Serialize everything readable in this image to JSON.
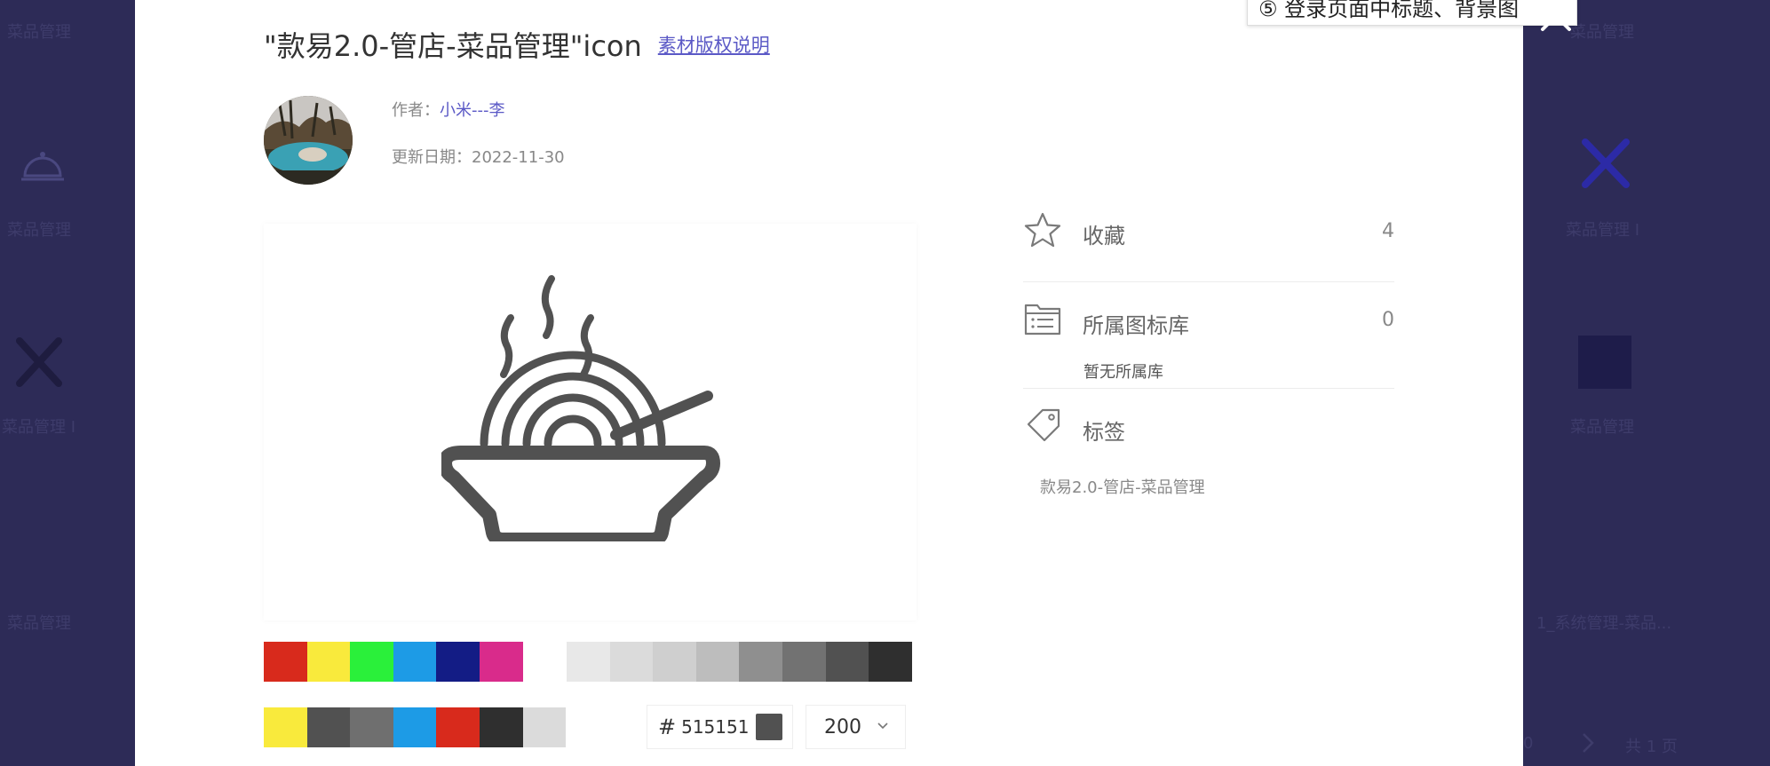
{
  "background": {
    "left_labels": [
      "菜品管理",
      "菜品管理",
      "菜品管理 I",
      "菜品管理"
    ],
    "right_labels": [
      "菜品管理",
      "菜品管理 I",
      "菜品管理",
      "1_系统管理-菜品..."
    ],
    "pager_total": "共 1 页",
    "pager_prev": "0"
  },
  "modal": {
    "title": "\"款易2.0-管店-菜品管理\"icon",
    "copyright_link": "素材版权说明",
    "author_label": "作者：",
    "author_name": "小米---李",
    "date_label": "更新日期：",
    "date_value": "2022-11-30",
    "tooltip": "⑤ 登录页面中标题、背景图",
    "close_icon": "close-icon",
    "preview_icon": "noodle-bowl-icon",
    "preview_color": "#515151"
  },
  "colors": {
    "row1_saturated": [
      "#d82a1c",
      "#f9ea3c",
      "#2af03a",
      "#1d9be6",
      "#131c85",
      "#d92b8b"
    ],
    "row1_grays": [
      "#e8e8e8",
      "#dbdbdb",
      "#cfcfcf",
      "#bdbdbd",
      "#8f8f8f",
      "#727272",
      "#515151",
      "#2f2f2f"
    ],
    "row2_recent": [
      "#f9ea3c",
      "#515151",
      "#6f6f6f",
      "#1d9be6",
      "#d82a1c",
      "#2f2f2f",
      "#dbdbdb"
    ]
  },
  "controls": {
    "hash": "#",
    "hex_value": "515151",
    "size_value": "200"
  },
  "info": {
    "favorite_label": "收藏",
    "favorite_count": "4",
    "library_label": "所属图标库",
    "library_count": "0",
    "library_empty": "暂无所属库",
    "tags_label": "标签",
    "tag_value": "款易2.0-管店-菜品管理"
  },
  "accent": "#5b59c6"
}
